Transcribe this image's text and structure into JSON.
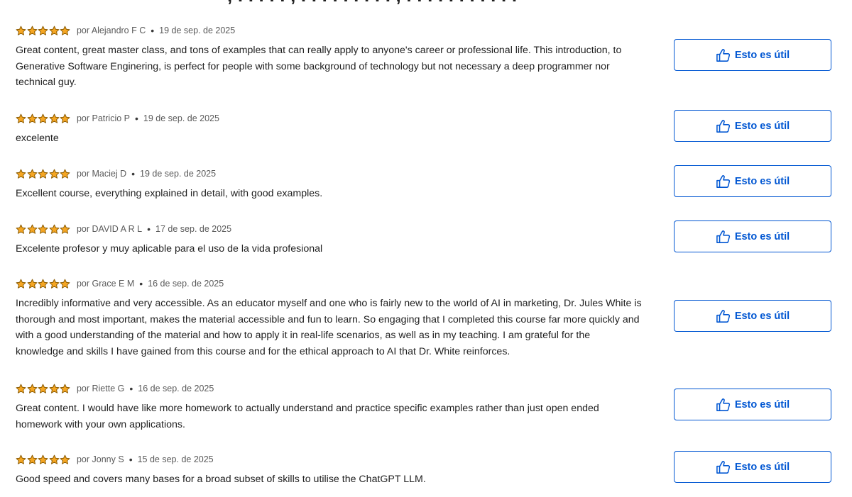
{
  "heading_fragment": ", . . . . . , . . . . . . . . . ,   . . . .  . . . .  . . .",
  "colors": {
    "star": "#f5a623",
    "accent": "#0056d2",
    "meta_text": "#5a5a5a",
    "body_text": "#1f1f1f"
  },
  "icons": {
    "star": "star-icon",
    "thumb": "thumbs-up-icon"
  },
  "reviews": [
    {
      "rating": 5,
      "author": "por Alejandro F C",
      "date": "19 de sep. de 2025",
      "lines": [
        "Great content, great master class, and tons of examples that can really apply to anyone's career or professional life. This introduction, to",
        "Generative Software Enginering, is perfect for people with some background of technology but not necessary a deep programmer nor",
        "technical guy."
      ],
      "button_label": "Esto es útil"
    },
    {
      "rating": 5,
      "author": "por Patricio P",
      "date": "19 de sep. de 2025",
      "lines": [
        "excelente"
      ],
      "button_label": "Esto es útil"
    },
    {
      "rating": 5,
      "author": "por Maciej D",
      "date": "19 de sep. de 2025",
      "lines": [
        "Excellent course, everything explained in detail, with good examples."
      ],
      "button_label": "Esto es útil"
    },
    {
      "rating": 5,
      "author": "por DAVID A R L",
      "date": "17 de sep. de 2025",
      "lines": [
        "Excelente profesor y muy aplicable para el uso de la vida profesional"
      ],
      "button_label": "Esto es útil"
    },
    {
      "rating": 5,
      "author": "por Grace E M",
      "date": "16 de sep. de 2025",
      "lines": [
        "Incredibly informative and very accessible. As an educator myself and one who is fairly new to the world of AI in marketing, Dr. Jules White is",
        "thorough and most important, makes the material accessible and fun to learn. So engaging that I completed this course far more quickly and",
        "with a good understanding of the material and how to apply it in real-life scenarios, as well as in my teaching. I am grateful for the",
        "knowledge and skills I have gained from this course and for the ethical approach to AI that Dr. White reinforces."
      ],
      "button_label": "Esto es útil"
    },
    {
      "rating": 5,
      "author": "por Riette G",
      "date": "16 de sep. de 2025",
      "lines": [
        "Great content.  I would have like more homework to actually understand and practice specific examples rather than just open ended",
        "homework with your own applications."
      ],
      "button_label": "Esto es útil"
    },
    {
      "rating": 5,
      "author": "por Jonny S",
      "date": "15 de sep. de 2025",
      "lines": [
        "Good speed and covers many bases for a broad subset of skills to utilise the ChatGPT LLM."
      ],
      "button_label": "Esto es útil"
    }
  ]
}
